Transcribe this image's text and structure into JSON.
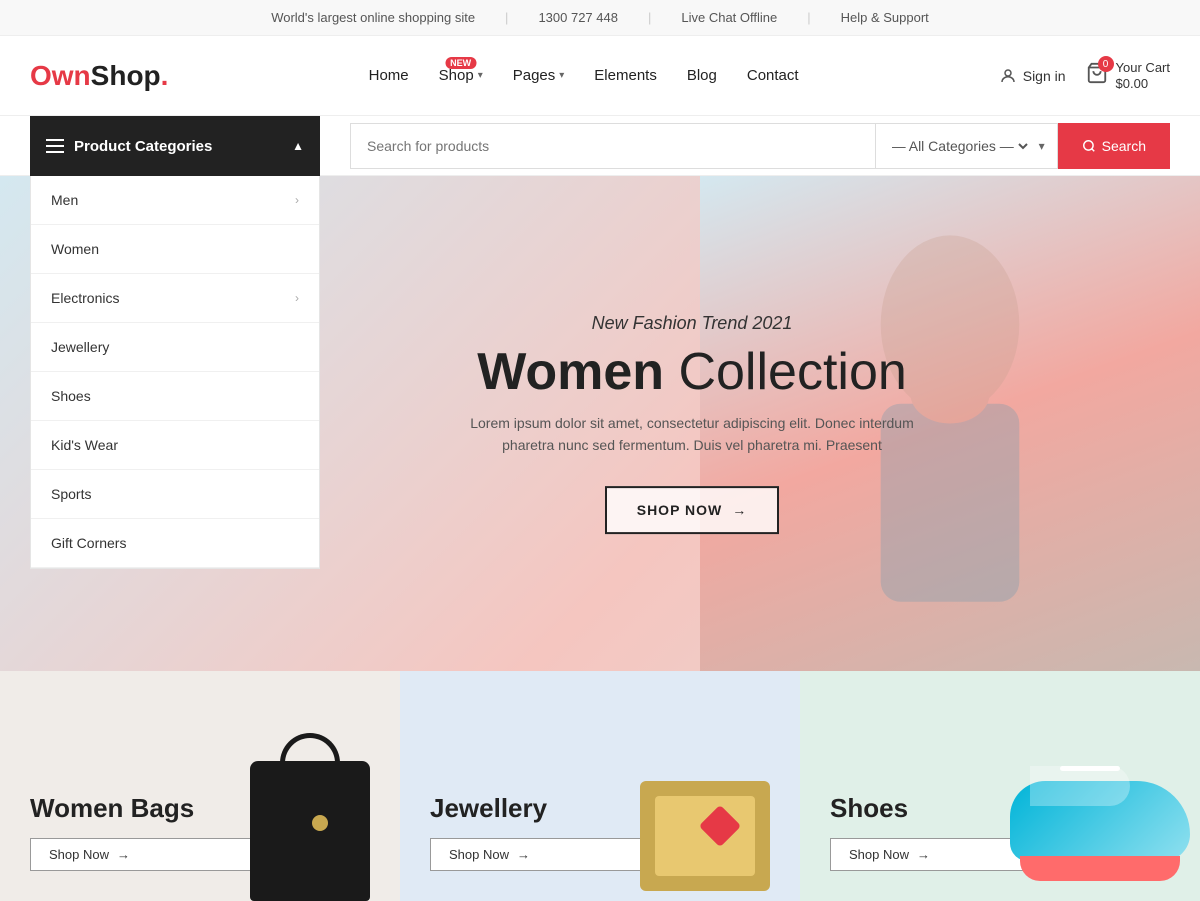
{
  "topbar": {
    "tagline": "World's largest online shopping site",
    "phone": "1300 727 448",
    "chat": "Live Chat Offline",
    "help": "Help & Support"
  },
  "header": {
    "logo_own": "Own",
    "logo_shop": "Shop",
    "logo_dot": ".",
    "nav": {
      "home": "Home",
      "shop": "Shop",
      "pages": "Pages",
      "elements": "Elements",
      "blog": "Blog",
      "contact": "Contact",
      "new_badge": "NEW"
    },
    "signin": "Sign in",
    "cart_count": "0",
    "cart_label": "Your Cart",
    "cart_total": "$0.00"
  },
  "search": {
    "placeholder": "Search for products",
    "category_default": "— All Categories —",
    "button": "Search"
  },
  "sidebar": {
    "title": "Product Categories",
    "items": [
      {
        "label": "Men",
        "has_sub": true
      },
      {
        "label": "Women",
        "has_sub": false
      },
      {
        "label": "Electronics",
        "has_sub": true
      },
      {
        "label": "Jewellery",
        "has_sub": false
      },
      {
        "label": "Shoes",
        "has_sub": false
      },
      {
        "label": "Kid's Wear",
        "has_sub": false
      },
      {
        "label": "Sports",
        "has_sub": false
      },
      {
        "label": "Gift Corners",
        "has_sub": false
      }
    ]
  },
  "hero": {
    "subtitle": "New Fashion Trend 2021",
    "title_bold": "Women",
    "title_normal": " Collection",
    "description": "Lorem ipsum dolor sit amet, consectetur adipiscing elit. Donec interdum pharetra nunc sed fermentum. Duis vel pharetra mi. Praesent",
    "cta": "SHOP NOW"
  },
  "feature_cards": [
    {
      "title": "Women Bags",
      "cta": "Shop Now"
    },
    {
      "title": "Jewellery",
      "cta": "Shop Now"
    },
    {
      "title": "Shoes",
      "cta": "Shop Now"
    }
  ]
}
